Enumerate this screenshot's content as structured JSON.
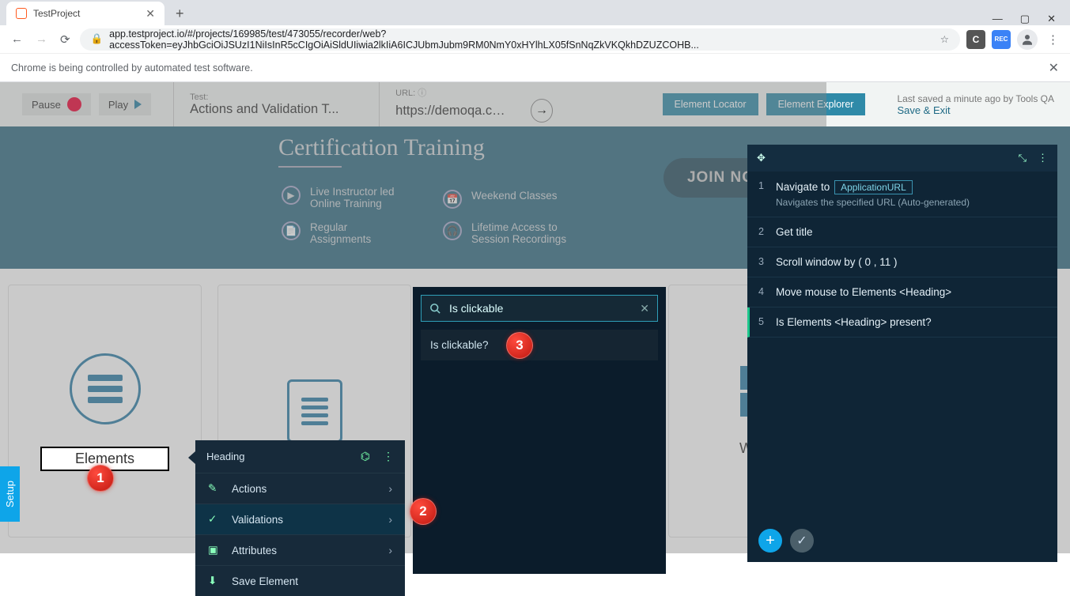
{
  "browser": {
    "tab_title": "TestProject",
    "url_display": "app.testproject.io/#/projects/169985/test/473055/recorder/web?accessToken=eyJhbGciOiJSUzI1NiIsInR5cCIgOiAiSldUIiwia2lkIiA6ICJUbmJubm9RM0NmY0xHYlhLX05fSnNqZkVKQkhDZUZCOHB...",
    "infobar_text": "Chrome is being controlled by automated test software."
  },
  "header": {
    "pause_label": "Pause",
    "play_label": "Play",
    "test_label": "Test:",
    "test_name": "Actions and Validation T...",
    "url_label": "URL:",
    "url_value": "https://demoqa.com/",
    "locator_btn": "Element Locator",
    "explorer_btn": "Element Explorer",
    "saved_text": "Last saved a minute ago by Tools QA",
    "save_exit": "Save & Exit"
  },
  "banner": {
    "title": "Certification Training",
    "feat1a": "Live Instructor led",
    "feat1b": "Online Training",
    "feat2a": "Regular",
    "feat2b": "Assignments",
    "feat3": "Weekend Classes",
    "feat4a": "Lifetime Access to",
    "feat4b": "Session Recordings",
    "join": "JOIN NOW"
  },
  "cards": {
    "elements": "Elements",
    "widgets": "Widgets"
  },
  "setup": "Setup",
  "context_menu": {
    "header": "Heading",
    "actions": "Actions",
    "validations": "Validations",
    "attributes": "Attributes",
    "save_element": "Save Element"
  },
  "search": {
    "value": "Is clickable",
    "result": "Is clickable?"
  },
  "steps": {
    "s1_title": "Navigate to",
    "s1_badge": "ApplicationURL",
    "s1_sub": "Navigates the specified URL (Auto-generated)",
    "s2_title": "Get title",
    "s3_title": "Scroll window by ( 0 , 11 )",
    "s4_title": "Move mouse to Elements <Heading>",
    "s5_title": "Is Elements <Heading> present?"
  },
  "markers": {
    "m1": "1",
    "m2": "2",
    "m3": "3"
  }
}
